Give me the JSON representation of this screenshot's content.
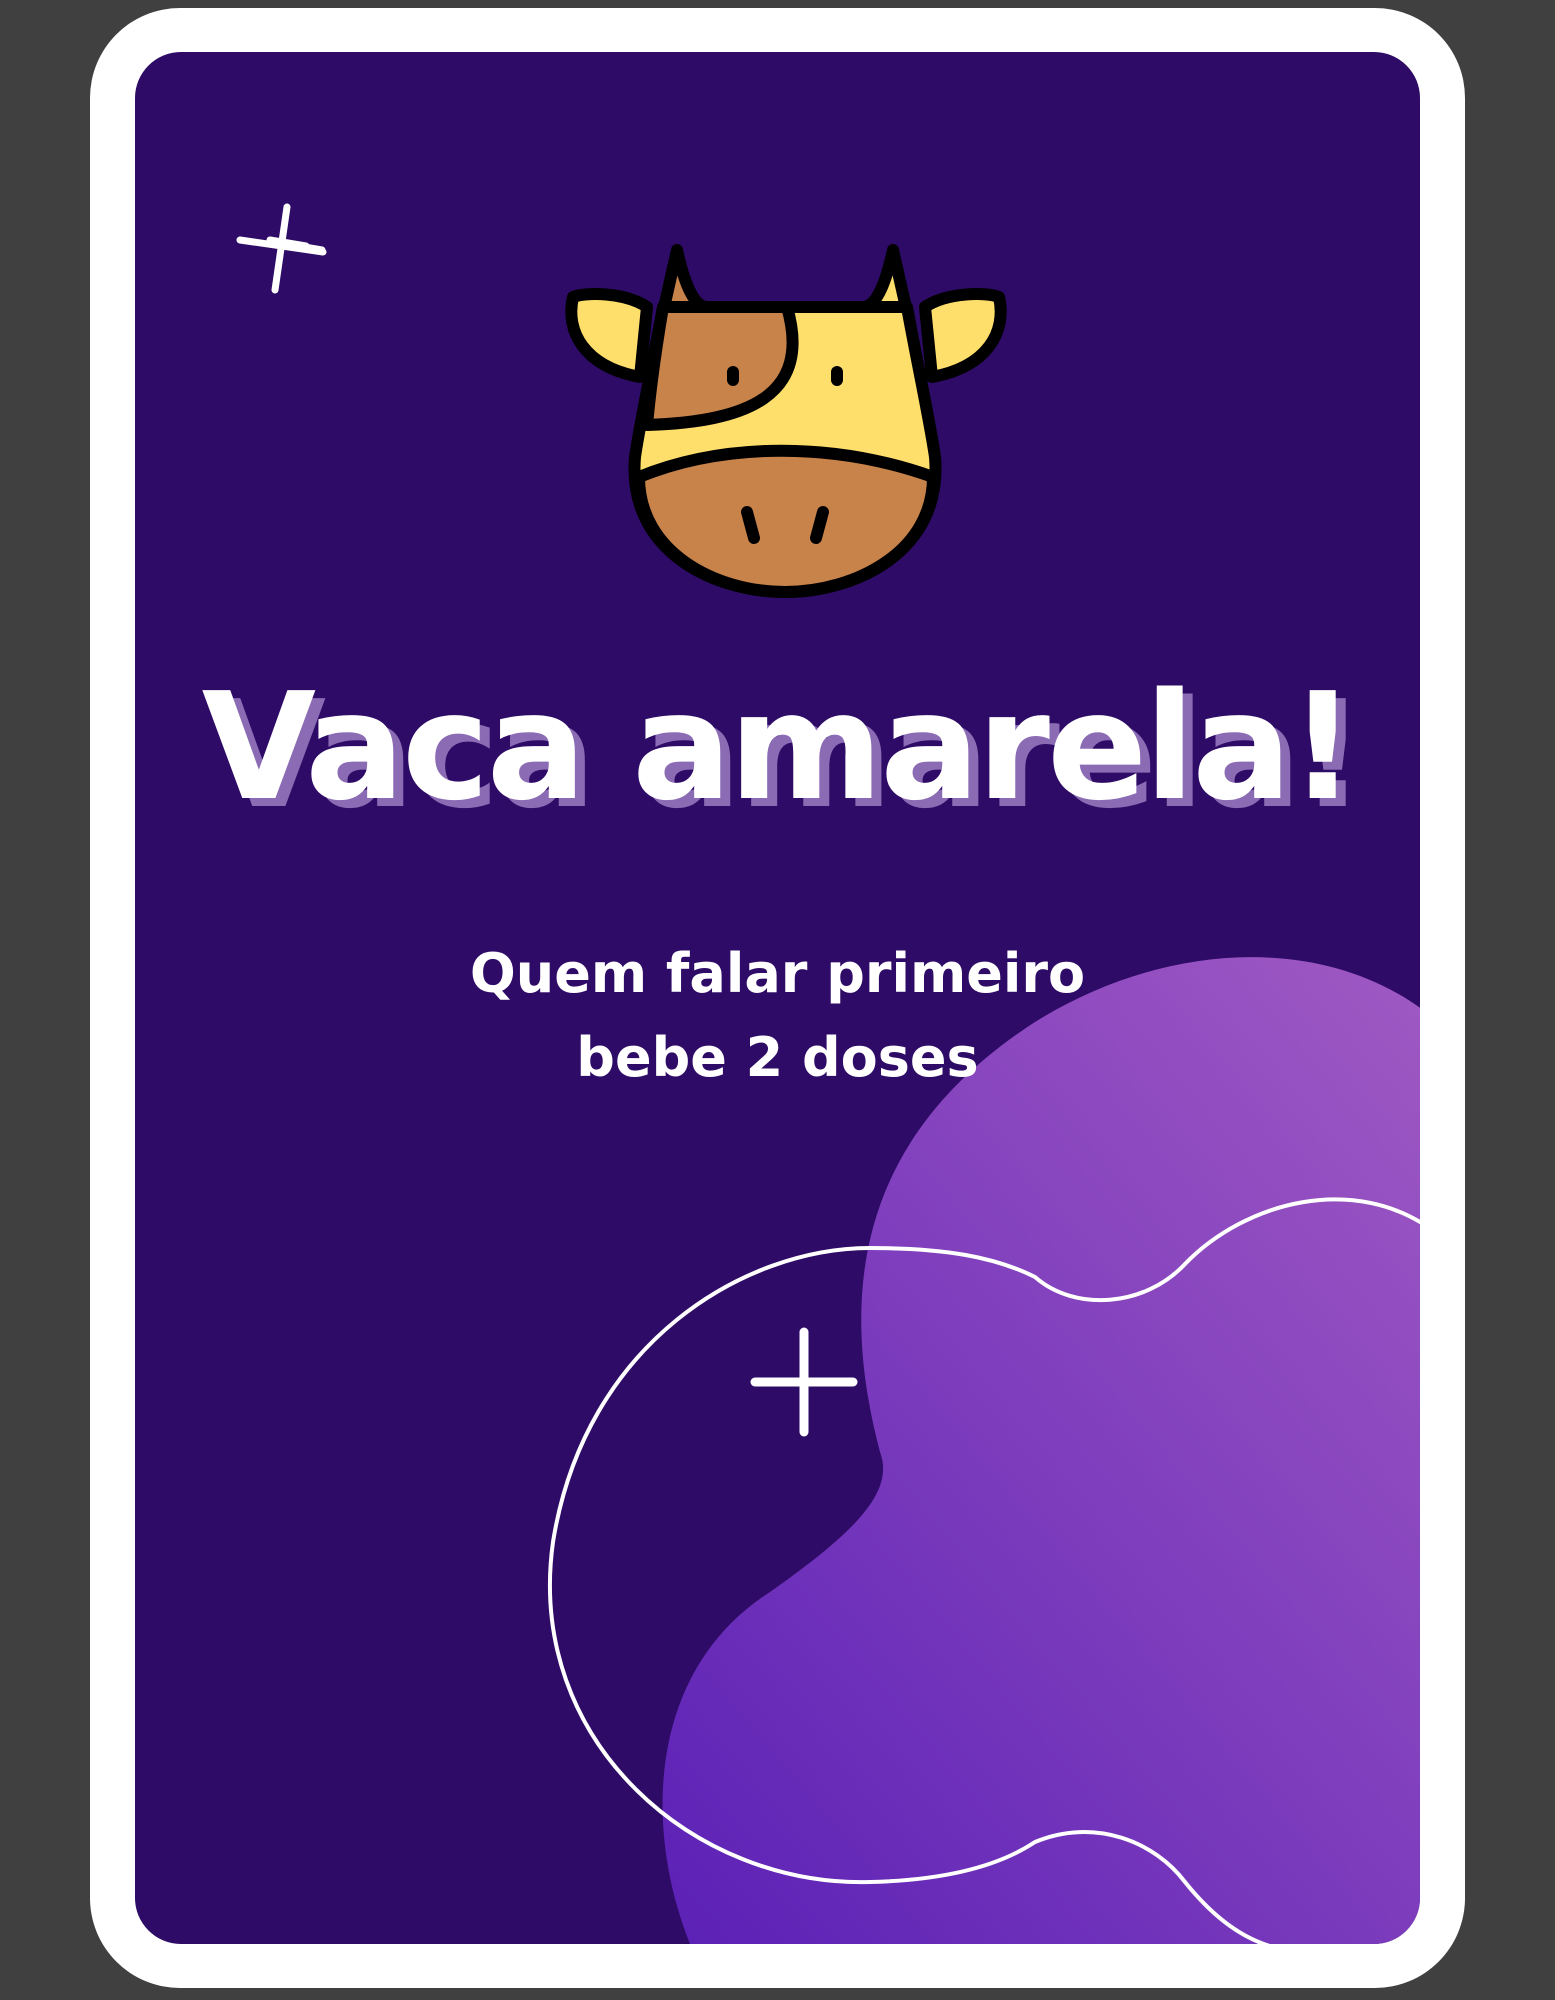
{
  "card": {
    "title": "Vaca amarela!",
    "subtitle": "Quem falar primeiro bebe 2 doses",
    "icon": "cow-face-icon"
  },
  "colors": {
    "page_background": "#404040",
    "card_border": "#ffffff",
    "card_background": "#2e0b66",
    "blob_gradient_start": "#5b21b6",
    "blob_gradient_end": "#9b59c2",
    "title_shadow": "#8a6bb4",
    "cow_yellow": "#ffdf6b",
    "cow_brown": "#c8834a"
  }
}
